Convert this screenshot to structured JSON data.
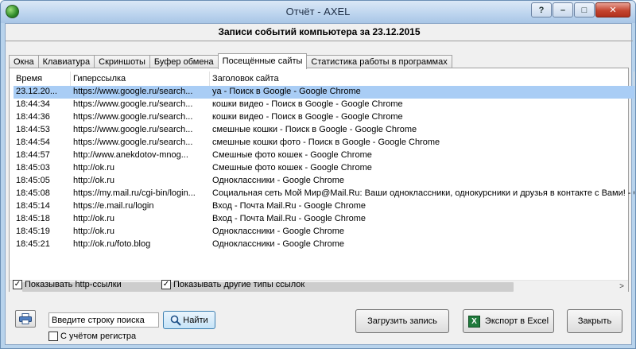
{
  "window": {
    "title": "Отчёт - AXEL",
    "caption_help": "?",
    "caption_min": "–",
    "caption_max": "□",
    "caption_close": "✕"
  },
  "header": {
    "subtitle": "Записи событий компьютера за 23.12.2015"
  },
  "tabs": [
    {
      "label": "Окна"
    },
    {
      "label": "Клавиатура"
    },
    {
      "label": "Скриншоты"
    },
    {
      "label": "Буфер обмена"
    },
    {
      "label": "Посещённые сайты",
      "active": true
    },
    {
      "label": "Статистика работы в программах"
    }
  ],
  "table": {
    "columns": [
      "Время",
      "Гиперссылка",
      "Заголовок сайта"
    ],
    "rows": [
      [
        "23.12.20...",
        "https://www.google.ru/search...",
        "ya - Поиск в Google - Google Chrome"
      ],
      [
        "18:44:34",
        "https://www.google.ru/search...",
        "кошки видео - Поиск в Google - Google Chrome"
      ],
      [
        "18:44:36",
        "https://www.google.ru/search...",
        "кошки видео - Поиск в Google - Google Chrome"
      ],
      [
        "18:44:53",
        "https://www.google.ru/search...",
        "смешные кошки - Поиск в Google - Google Chrome"
      ],
      [
        "18:44:54",
        "https://www.google.ru/search...",
        "смешные кошки фото - Поиск в Google - Google Chrome"
      ],
      [
        "18:44:57",
        "http://www.anekdotov-mnog...",
        "Смешные фото кошек - Google Chrome"
      ],
      [
        "18:45:03",
        "http://ok.ru",
        "Смешные фото кошек - Google Chrome"
      ],
      [
        "18:45:05",
        "http://ok.ru",
        "Одноклассники - Google Chrome"
      ],
      [
        "18:45:08",
        "https://my.mail.ru/cgi-bin/login...",
        "Социальная сеть Мой Мир@Mail.Ru: Ваши одноклассники, однокурсники и друзья в контакте с Вами! - Google Chrome"
      ],
      [
        "18:45:14",
        "https://e.mail.ru/login",
        "Вход - Почта Mail.Ru - Google Chrome"
      ],
      [
        "18:45:18",
        "http://ok.ru",
        "Вход - Почта Mail.Ru - Google Chrome"
      ],
      [
        "18:45:19",
        "http://ok.ru",
        "Одноклассники - Google Chrome"
      ],
      [
        "18:45:21",
        "http://ok.ru/foto.blog",
        "Одноклассники - Google Chrome"
      ]
    ],
    "selected_row": 0,
    "scroll_left_arrow": "<",
    "scroll_right_arrow": ">"
  },
  "options": {
    "show_http_label": "Показывать http-ссылки",
    "show_http_checked": true,
    "show_other_label": "Показывать другие типы ссылок",
    "show_other_checked": true
  },
  "search": {
    "value": "Введите строку поиска",
    "find_label": "Найти",
    "case_label": "С учётом регистра",
    "case_checked": false
  },
  "actions": {
    "load_label": "Загрузить запись",
    "export_label": "Экспорт в Excel",
    "export_icon_glyph": "X",
    "close_label": "Закрыть"
  }
}
